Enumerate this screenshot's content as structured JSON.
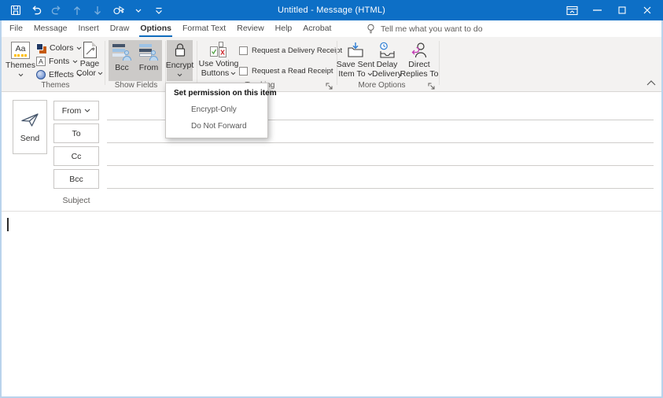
{
  "colors": {
    "titlebar": "#0d6fc6",
    "accent": "#0f6cbd",
    "pressed_gray": "#cccac8"
  },
  "titlebar": {
    "title": "Untitled  -  Message (HTML)"
  },
  "tabs": {
    "items": [
      {
        "label": "File"
      },
      {
        "label": "Message"
      },
      {
        "label": "Insert"
      },
      {
        "label": "Draw"
      },
      {
        "label": "Options",
        "active": true
      },
      {
        "label": "Format Text"
      },
      {
        "label": "Review"
      },
      {
        "label": "Help"
      },
      {
        "label": "Acrobat"
      }
    ],
    "tell_me": "Tell me what you want to do"
  },
  "ribbon": {
    "themes": {
      "group_label": "Themes",
      "themes_label": "Themes",
      "aa": "Aa",
      "colors_label": "Colors",
      "fonts_label": "Fonts",
      "fonts_a": "A",
      "effects_label": "Effects",
      "page_color_line1": "Page",
      "page_color_line2": "Color"
    },
    "show_fields": {
      "group_label": "Show Fields",
      "bcc_label": "Bcc",
      "from_label": "From"
    },
    "permission": {
      "encrypt_label": "Encrypt"
    },
    "tracking": {
      "group_label": "Tracking",
      "voting_line1": "Use Voting",
      "voting_line2": "Buttons",
      "delivery_receipt_label": "Request a Delivery Receipt",
      "read_receipt_label": "Request a Read Receipt"
    },
    "more_options": {
      "group_label": "More Options",
      "save_line1": "Save Sent",
      "save_line2": "Item To",
      "delay_line1": "Delay",
      "delay_line2": "Delivery",
      "direct_line1": "Direct",
      "direct_line2": "Replies To"
    }
  },
  "encrypt_menu": {
    "header": "Set permission on this item",
    "items": [
      {
        "label": "Encrypt-Only"
      },
      {
        "label": "Do Not Forward"
      }
    ]
  },
  "compose": {
    "send_label": "Send",
    "from_label": "From",
    "to_label": "To",
    "cc_label": "Cc",
    "bcc_label": "Bcc",
    "subject_label": "Subject"
  }
}
